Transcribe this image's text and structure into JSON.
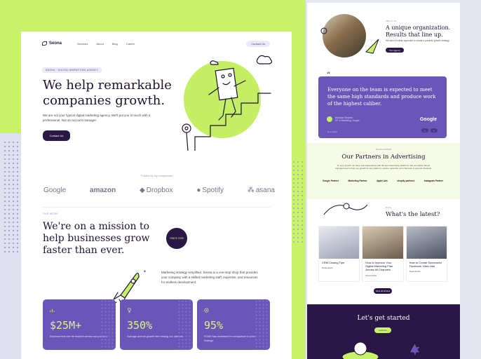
{
  "nav": {
    "brand": "Seona",
    "links": [
      "Services",
      "About",
      "Blog",
      "Career"
    ],
    "cta": "Contact Us"
  },
  "hero": {
    "pill": "SEONA · DIGITAL MARKETING AGENCY",
    "title": "We help remarkable companies growth.",
    "lead": "We are not your typical digital marketing agency. We'll put you in touch with a professional. Not an account manager.",
    "button": "Contact Us"
  },
  "trusted": {
    "label": "Trusted by top companies",
    "logos": [
      "Google",
      "amazon",
      "Dropbox",
      "Spotify",
      "asana"
    ]
  },
  "mission": {
    "tag": "OUR WORK",
    "title": "We're on a mission to help businesses grow faster than ever.",
    "badge": "SINCE 2005",
    "paragraph": "Marketing strategy simplified. Seona is a one-stop shop that provides your company with a skilled marketing staff, expertise, and resources for endless development."
  },
  "stats": [
    {
      "value": "$25M+",
      "caption": "Revenue that can be tracked across our portfolio"
    },
    {
      "value": "350%",
      "caption": "Average annual growth rate among our clientele"
    },
    {
      "value": "95%",
      "caption": "ROAS has increased in comparison to prior findings."
    }
  ],
  "about": {
    "tag": "ABOUT US",
    "title": "A unique organization. Results that line up.",
    "sub": "We take a holistic approach to create a powerful growth strategy.",
    "button": "Our Agency"
  },
  "testimonial": {
    "quote": "Everyone on the team is expected to meet the same high standards and produce work of the highest caliber.",
    "name": "Nicholas Stephen",
    "role": "VP of Marketing, Google",
    "company": "Google",
    "foot": "Next client"
  },
  "partners": {
    "tag": "SEONA EXPERT",
    "title": "Our Partners in Advertising",
    "sub": "To spur growth, we have real relationships with the best advertising platforms. We are highly trained and approved to help you growth for any platform, explore networks, and channels, in general channels.",
    "logos": [
      "Google Partner",
      "Marketing Partner",
      "Apple Ads",
      "shopify partners",
      "Instagram Partner"
    ]
  },
  "latest": {
    "tag": "BLOG",
    "title": "What's the latest?",
    "posts": [
      {
        "title": "CRM Closing Tips",
        "read": "Read article"
      },
      {
        "title": "How to Improve Your Digital Marketing Plan Across All Channels",
        "read": "Read article"
      },
      {
        "title": "How to Create Successful Facebook Video Ads",
        "read": "Read article"
      }
    ],
    "view_all": "View all articles"
  },
  "cta": {
    "title": "Let's get started",
    "button": "Let's Go"
  },
  "colors": {
    "lime": "#c8f26a",
    "purple": "#6a55b8",
    "dark": "#2a1745"
  }
}
